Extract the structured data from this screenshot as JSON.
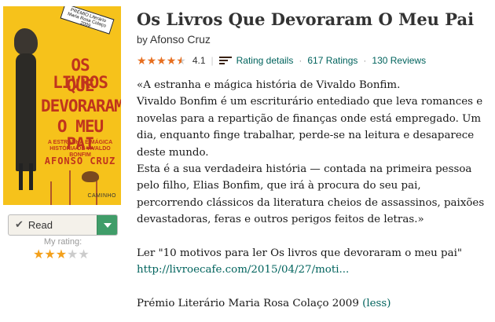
{
  "cover": {
    "award_line1": "PRÉMIO Literário",
    "award_line2": "Maria Rosa Colaço",
    "award_line3": "2009",
    "title_lines": [
      "OS LIVROS",
      "QUE",
      "DEVORARAM",
      "O MEU PAI"
    ],
    "subtitle": "A ESTRANHA E MÁGICA HISTÓRIA DE VIVALDO BONFIM",
    "author": "AFONSO CRUZ",
    "publisher": "CAMINHO"
  },
  "shelf": {
    "label": "Read",
    "check_icon": "check-icon",
    "dropdown_icon": "chevron-down-icon",
    "accent": "#409d69"
  },
  "my_rating": {
    "label": "My rating:",
    "value": 3,
    "max": 5,
    "filled_color": "#f3a01b",
    "empty_color": "#cccccc"
  },
  "book": {
    "title": "Os Livros Que Devoraram O Meu Pai",
    "by": "by",
    "author": "Afonso Cruz"
  },
  "rating": {
    "stars": 4.1,
    "average": "4.1",
    "details_label": "Rating details",
    "ratings": "617 Ratings",
    "reviews": "130 Reviews",
    "star_color": "#e76f20",
    "link_color": "#00635d"
  },
  "description": {
    "lines": [
      "«A estranha e mágica história de Vivaldo Bonfim.",
      "Vivaldo Bonfim é um escriturário entediado que leva romances e",
      "novelas para a repartição de finanças onde está empregado. Um",
      "dia, enquanto finge trabalhar, perde-se na leitura e desaparece",
      "deste mundo.",
      "Esta é a sua verdadeira história — contada na primeira pessoa",
      "pelo filho, Elias Bonfim, que irá à procura do seu pai,",
      "percorrendo clássicos da literatura cheios de assassinos, paixões",
      "devastadoras, feras e outros perigos feitos de letras.»"
    ],
    "ler_line": "Ler \"10 motivos para ler Os livros que devoraram o meu pai\"",
    "url": "http://livroecafe.com/2015/04/27/moti...",
    "award": "Prémio Literário Maria Rosa Colaço 2009",
    "less": "(less)"
  }
}
